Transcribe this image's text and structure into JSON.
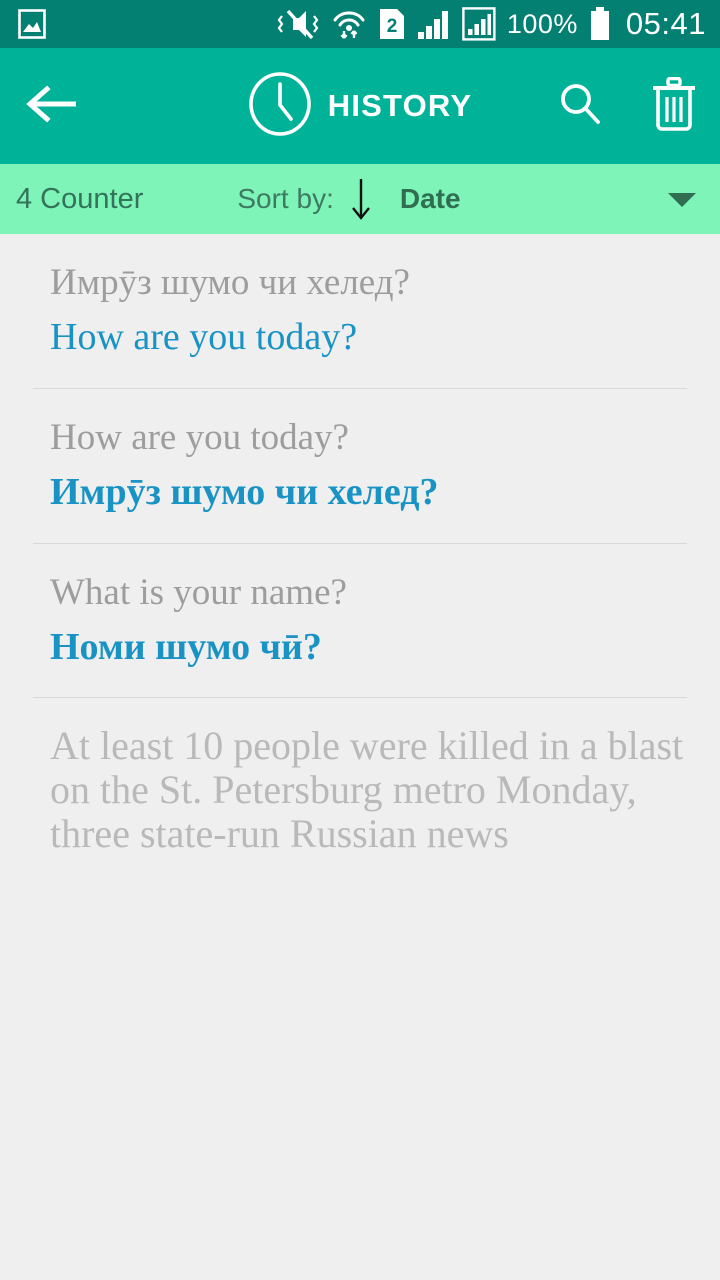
{
  "statusbar": {
    "gallery_icon": "image-icon",
    "mute_icon": "mute-vibrate-icon",
    "wifi_icon": "wifi-data-icon",
    "sim_icon": "sim2-icon",
    "sim_label": "2",
    "signal1_icon": "signal-bars-icon",
    "signal2_icon": "signal-bars-boxed-icon",
    "battery_percent": "100%",
    "battery_icon": "battery-full-icon",
    "time": "05:41",
    "background": "#048073"
  },
  "appbar": {
    "back_icon": "back-arrow-icon",
    "clock_icon": "clock-icon",
    "title": "HISTORY",
    "search_icon": "search-icon",
    "delete_icon": "trash-icon",
    "background": "#00b398"
  },
  "sortbar": {
    "counter": "4 Counter",
    "sort_label": "Sort by:",
    "sort_direction_icon": "arrow-down-icon",
    "sort_value": "Date",
    "dropdown_icon": "chevron-down-icon",
    "background": "#7ef4b8"
  },
  "history": {
    "accent_color": "#1993c4",
    "muted_color": "#9d9d9d",
    "items": [
      {
        "source": "Имрӯз шумо чи хелед?",
        "target": "How are you today?",
        "target_bold": false
      },
      {
        "source": "How are you today?",
        "target": "Имрӯз шумо чи хелед?",
        "target_bold": true
      },
      {
        "source": "What is your name?",
        "target": "Номи шумо чӣ?",
        "target_bold": true
      },
      {
        "source": "At least 10 people were killed in a blast on the St. Petersburg metro Monday, three state-run Russian news",
        "target": "",
        "target_bold": false
      }
    ]
  }
}
